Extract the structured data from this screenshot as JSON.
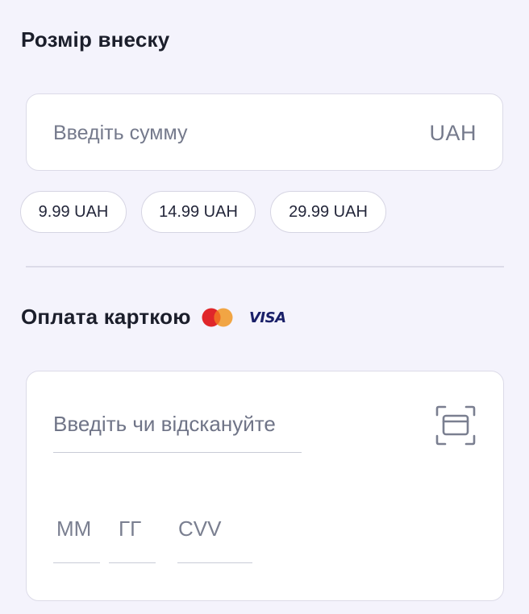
{
  "amount": {
    "title": "Розмір внеску",
    "placeholder": "Введіть сумму",
    "currency": "UAH",
    "presets": [
      "9.99 UAH",
      "14.99 UAH",
      "29.99 UAH"
    ]
  },
  "card": {
    "title": "Оплата карткою",
    "brands": [
      "mastercard-icon",
      "VISA"
    ],
    "number_placeholder": "Введіть чи відскануйте",
    "expiry_month_placeholder": "ММ",
    "expiry_year_placeholder": "ГГ",
    "cvv_placeholder": "CVV",
    "scan_icon": "scan-card-icon"
  },
  "colors": {
    "background": "#f4f3fc",
    "mastercard_red": "#e0262a",
    "mastercard_orange": "#f0a03a",
    "visa_blue": "#1a2069"
  }
}
